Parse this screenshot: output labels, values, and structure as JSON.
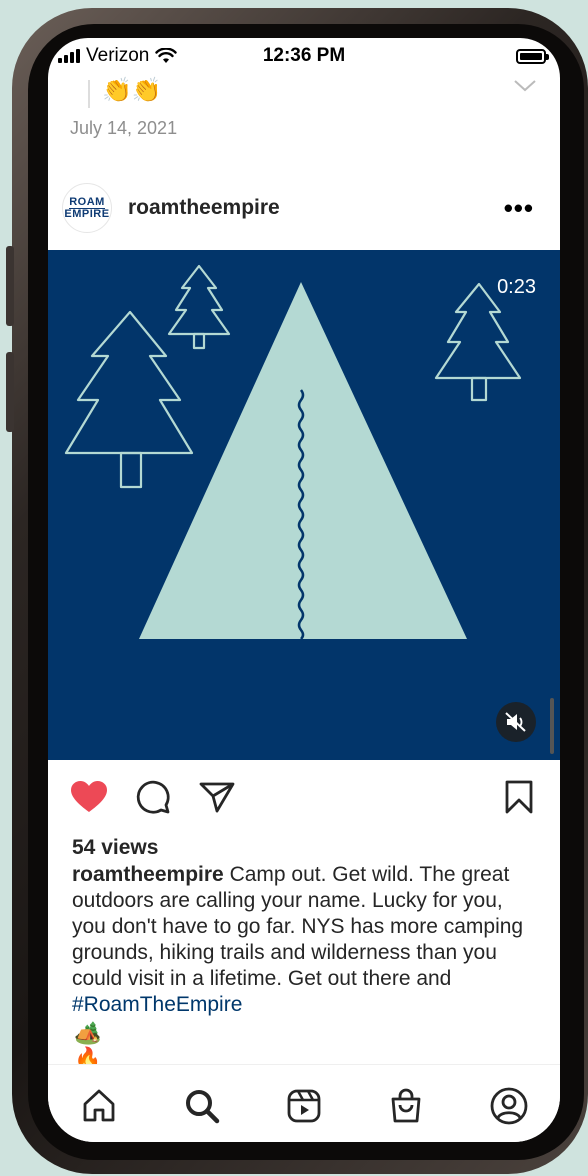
{
  "status_bar": {
    "carrier": "Verizon",
    "time": "12:36 PM"
  },
  "previous_post": {
    "emoji": "👏👏",
    "date": "July 14, 2021"
  },
  "post": {
    "username": "roamtheempire",
    "avatar_logo_text": [
      "ROAM",
      "EMPIRE"
    ],
    "more_label": "•••",
    "video_time": "0:23",
    "views": "54 views",
    "caption_user": "roamtheempire",
    "caption_text": "Camp out. Get wild. The great outdoors are calling your name. Lucky for you, you don't have to go far. NYS has more camping grounds, hiking trails and wilderness than you could visit in a lifetime. Get out there and ",
    "caption_hashtag": "#RoamTheEmpire",
    "caption_emojis": [
      "🏕️",
      "🔥"
    ],
    "liked": true
  },
  "colors": {
    "media_bg": "#02356a",
    "tent": "#b4d9d3",
    "like_red": "#ed4956",
    "hashtag": "#00376b"
  },
  "icons": {
    "actions": [
      "heart-icon",
      "comment-icon",
      "share-icon",
      "bookmark-icon"
    ],
    "tabs": [
      "home-icon",
      "search-icon",
      "reels-icon",
      "shop-icon",
      "profile-icon"
    ]
  }
}
